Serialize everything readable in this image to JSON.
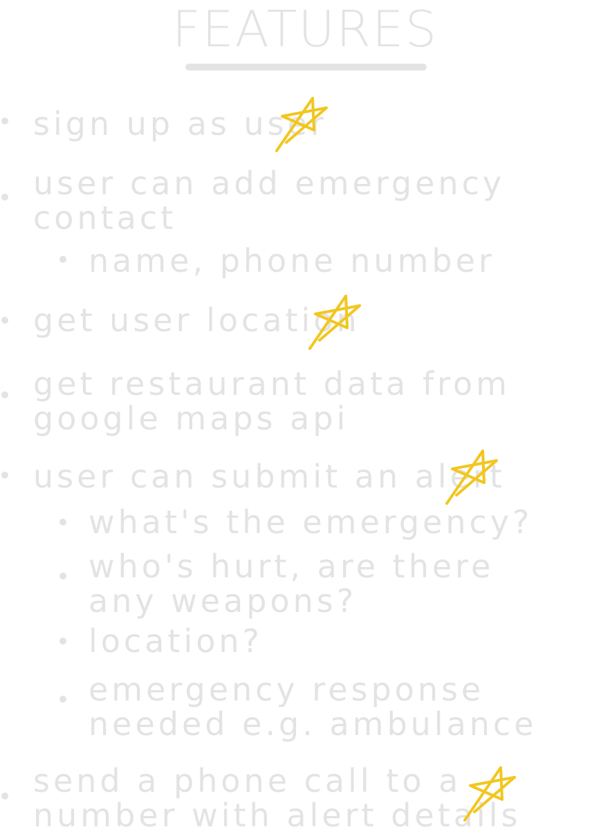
{
  "title": "FEATURES",
  "items": [
    {
      "text": "sign up as user",
      "starred": true
    },
    {
      "text_lines": [
        "user can add emergency",
        "contact"
      ],
      "starred": false
    },
    {
      "text": "name, phone number",
      "sub": true
    },
    {
      "text": "get user location",
      "starred": true
    },
    {
      "text_lines": [
        "get restaurant data from",
        "google maps api"
      ],
      "starred": false
    },
    {
      "text": "user can submit an alert",
      "starred": true
    },
    {
      "text": "what's the emergency?",
      "sub": true
    },
    {
      "text_lines": [
        "who's hurt, are there",
        "any weapons?"
      ],
      "sub": true
    },
    {
      "text": "location?",
      "sub": true
    },
    {
      "text_lines": [
        "emergency response",
        "needed e.g. ambulance"
      ],
      "sub": true
    },
    {
      "text_lines": [
        "send a phone call to a",
        "number with alert details"
      ],
      "starred": true
    }
  ],
  "colors": {
    "text": "#e3e3e3",
    "star": "#f2c61f"
  }
}
